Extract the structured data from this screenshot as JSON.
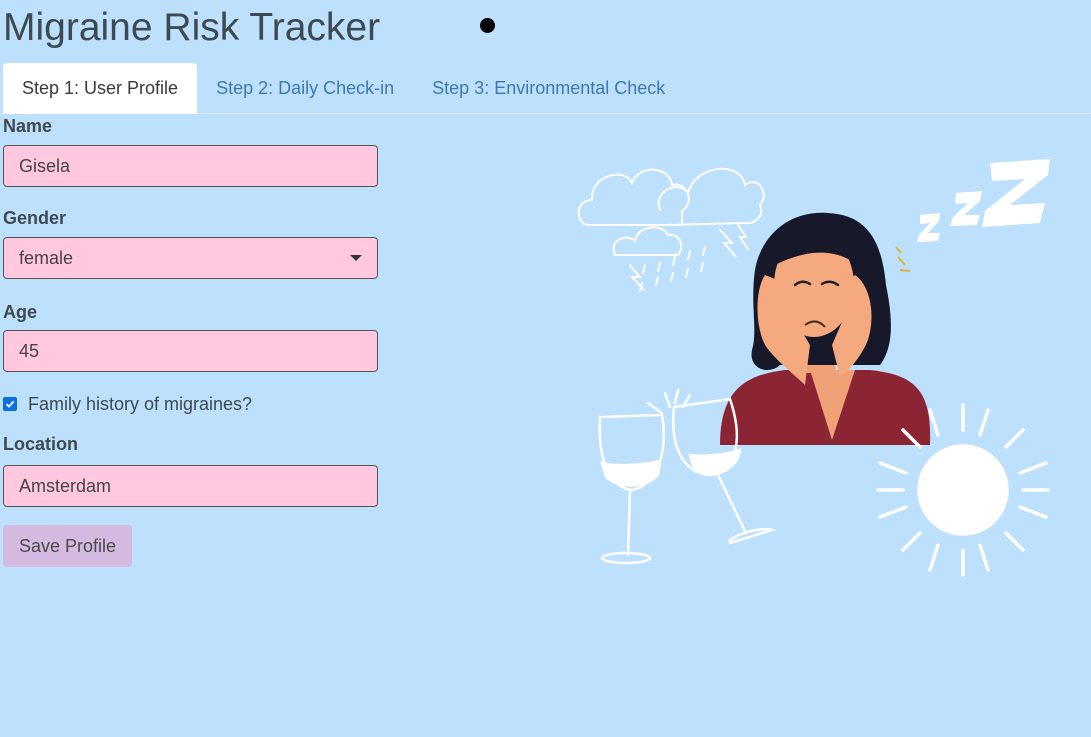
{
  "app": {
    "title": "Migraine Risk Tracker"
  },
  "tabs": [
    {
      "label": "Step 1: User Profile",
      "active": true
    },
    {
      "label": "Step 2: Daily Check-in",
      "active": false
    },
    {
      "label": "Step 3: Environmental Check",
      "active": false
    }
  ],
  "form": {
    "name": {
      "label": "Name",
      "value": "Gisela"
    },
    "gender": {
      "label": "Gender",
      "value": "female"
    },
    "age": {
      "label": "Age",
      "value": "45"
    },
    "family_history": {
      "label": "Family history of migraines?",
      "checked": true
    },
    "location": {
      "label": "Location",
      "value": "Amsterdam"
    },
    "save_label": "Save Profile"
  },
  "colors": {
    "background": "#bde0fc",
    "field_fill": "#ffc8de",
    "button_fill": "#d4b9e0",
    "tab_link": "#3c78b0",
    "checkbox": "#0b6fe0"
  },
  "icons": {
    "illustration": "woman-with-headache-illustration",
    "clouds": "storm-clouds-icon",
    "sleep": "zzz-icon",
    "wine": "wine-glasses-icon",
    "sun": "sun-icon"
  }
}
